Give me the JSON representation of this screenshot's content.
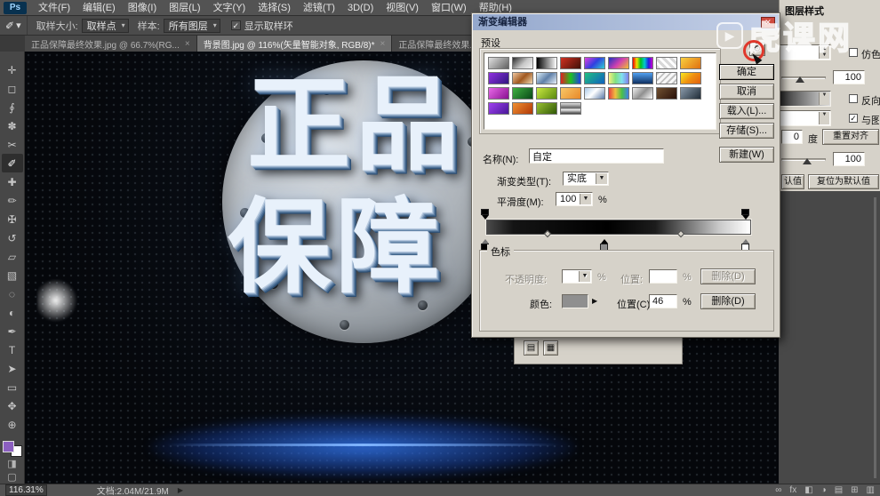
{
  "menu_bar": {
    "logo": "Ps",
    "items": [
      "文件(F)",
      "编辑(E)",
      "图像(I)",
      "图层(L)",
      "文字(Y)",
      "选择(S)",
      "滤镜(T)",
      "3D(D)",
      "视图(V)",
      "窗口(W)",
      "帮助(H)"
    ]
  },
  "options_bar": {
    "tool_glyph": "✐",
    "dropdown_arrow": "▾",
    "sample_size_label": "取样大小:",
    "sample_size_value": "取样点",
    "sample_label": "样本:",
    "sample_value": "所有图层",
    "check_glyph": "✓",
    "ring_label": "显示取样环"
  },
  "tabs": [
    {
      "label": "正品保障最终效果.jpg @ 66.7%(RG...",
      "close": "×"
    },
    {
      "label": "背景图.jpg @ 116%(矢量智能对象, RGB/8)*",
      "close": "×",
      "active": true
    },
    {
      "label": "正品保障最终效果.psd",
      "close": "×"
    }
  ],
  "toolbar": {
    "tools": [
      {
        "name": "move-tool",
        "glyph": "✛"
      },
      {
        "name": "marquee-tool",
        "glyph": "◻"
      },
      {
        "name": "lasso-tool",
        "glyph": "∮"
      },
      {
        "name": "quick-select-tool",
        "glyph": "✽"
      },
      {
        "name": "crop-tool",
        "glyph": "✂"
      },
      {
        "name": "eyedropper-tool",
        "glyph": "✐",
        "active": true
      },
      {
        "name": "spot-heal-tool",
        "glyph": "✚"
      },
      {
        "name": "brush-tool",
        "glyph": "✏"
      },
      {
        "name": "clone-stamp-tool",
        "glyph": "✠"
      },
      {
        "name": "history-brush-tool",
        "glyph": "↺"
      },
      {
        "name": "eraser-tool",
        "glyph": "▱"
      },
      {
        "name": "gradient-tool",
        "glyph": "▧"
      },
      {
        "name": "blur-tool",
        "glyph": "◌"
      },
      {
        "name": "dodge-tool",
        "glyph": "◐"
      },
      {
        "name": "pen-tool",
        "glyph": "✒"
      },
      {
        "name": "type-tool",
        "glyph": "T"
      },
      {
        "name": "path-select-tool",
        "glyph": "➤"
      },
      {
        "name": "shape-tool",
        "glyph": "▭"
      },
      {
        "name": "hand-tool",
        "glyph": "✥"
      },
      {
        "name": "zoom-tool",
        "glyph": "⊕"
      }
    ],
    "foreground_color": "#8b5fc0",
    "quick_mask_glyph": "◨",
    "screen_mode_glyph": "▢"
  },
  "canvas": {
    "title_line1": "正品",
    "title_line2": "保障",
    "glow_color": "#2f6fe0"
  },
  "gradient_editor": {
    "title": "渐变编辑器",
    "close_glyph": "✕",
    "presets_label": "预设",
    "gear_glyph": "⚙",
    "presets": [
      "linear-gradient(135deg,#e0e0e0,#606060)",
      "linear-gradient(135deg,#2a2a2a,#c8c8c8 55%,#f2f2f2)",
      "linear-gradient(90deg,#000000,#ffffff)",
      "linear-gradient(135deg,#d03020,#401008)",
      "linear-gradient(135deg,#e040e0,#3040e0,#30d0d0)",
      "linear-gradient(135deg,#2030c0,#d040b0,#f0c030)",
      "linear-gradient(90deg,#f00000,#f0e000,#00c020,#00c8d0,#2020e0,#d000d0)",
      "repeating-linear-gradient(45deg,#d8d8d8 0px,#d8d8d8 3px,#ffffff 3px,#ffffff 6px)",
      "linear-gradient(135deg,#f8d040,#e07010)",
      "linear-gradient(135deg,#9030e0,#301880)",
      "linear-gradient(135deg,#f0c8a0,#a05820,#f0d8b0)",
      "linear-gradient(135deg,#d8ecf8,#6080a8,#e8f0f8)",
      "linear-gradient(90deg,#e02020,#20c020,#2040e0)",
      "linear-gradient(135deg,#20c080,#1060c0)",
      "linear-gradient(90deg,#f8f080,#80e080,#80e0f0,#8080e8)",
      "linear-gradient(180deg,#50a0f0,#103060)",
      "repeating-linear-gradient(135deg,#c0c0c0 0px,#c0c0c0 2px,#f8f8f8 2px,#f8f8f8 5px)",
      "linear-gradient(135deg,#f8e820,#f09010,#e06010)",
      "linear-gradient(135deg,#e868e8,#881090)",
      "linear-gradient(135deg,#40b040,#084818)",
      "linear-gradient(135deg,#c8e840,#5a8810)",
      "linear-gradient(135deg,#f8c868,#e88828)",
      "linear-gradient(135deg,#a8c8e8,#ffffff 45%,#5878a8)",
      "linear-gradient(90deg,#e84040,#f0c040,#48c048,#4080e8)",
      "linear-gradient(135deg,#f0f0f0,#909090,#ffffff)",
      "linear-gradient(135deg,#705030,#281008)",
      "linear-gradient(135deg,#8898a8,#202c38)",
      "linear-gradient(135deg,#a040f0,#481898)",
      "linear-gradient(135deg,#f09030,#b03808)",
      "linear-gradient(135deg,#98c030,#305808)",
      "linear-gradient(180deg,#e0e0e0,#606060 45%,#f0f0f0 60%,#404040)"
    ],
    "ok": "确定",
    "cancel": "取消",
    "load": "载入(L)...",
    "save": "存储(S)...",
    "name_label": "名称(N):",
    "name_value": "自定",
    "new_button": "新建(W)",
    "type_label": "渐变类型(T):",
    "type_value": "实底",
    "smooth_label": "平滑度(M):",
    "smooth_value": "100",
    "percent": "%",
    "bar_css": "linear-gradient(90deg,#4a4a4a 0%,#141414 10%,#000000 46%,#1c1c1c 64%,#c8c8c8 88%,#ffffff 100%)",
    "stops_label": "色标",
    "opacity_label": "不透明度:",
    "position_label": "位置:",
    "delete_label": "删除(D)",
    "color_label": "颜色:",
    "color_value": "#8f8f8f",
    "color_arrow": "▶",
    "color_position_label": "位置(C):",
    "color_position_value": "46"
  },
  "layer_style_panel": {
    "title": "图层样式",
    "dither_label": "仿色",
    "opacity_value": "100",
    "reverse_label": "反向",
    "align_label": "与图层",
    "check_glyph": "✓",
    "angle_value": "0",
    "degree_label": "度",
    "reset_align_label": "重置对齐",
    "scale_value": "100",
    "set_default_label": "认值",
    "reset_default_label": "复位为默认值",
    "bottom_icon1": "▤",
    "bottom_icon2": "▦"
  },
  "watermark": {
    "logo_glyph": "▶",
    "text": "虎课网"
  },
  "status_bar": {
    "zoom": "116.31%",
    "doc_info": "文档:2.04M/21.9M",
    "flyout": "▶",
    "layer_buttons": [
      {
        "name": "link-layers-icon",
        "glyph": "∞"
      },
      {
        "name": "layer-style-fx-icon",
        "glyph": "fx"
      },
      {
        "name": "layer-mask-icon",
        "glyph": "◧"
      },
      {
        "name": "adjustment-layer-icon",
        "glyph": "◑"
      },
      {
        "name": "layer-group-icon",
        "glyph": "▤"
      },
      {
        "name": "new-layer-icon",
        "glyph": "⊞"
      },
      {
        "name": "delete-layer-icon",
        "glyph": "▥"
      }
    ]
  }
}
